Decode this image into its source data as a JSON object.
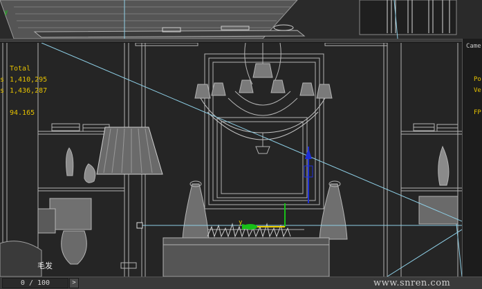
{
  "stats": {
    "total_label": "Total",
    "polys_prefix": "s",
    "polys_value": "1,410,295",
    "verts_prefix": "s",
    "verts_value": "1,436,287",
    "fps_value": "94.165"
  },
  "top_viewport": {
    "axis_label": "y"
  },
  "main_viewport": {
    "gizmo_label": "y",
    "object_label": "毛发"
  },
  "right_panel": {
    "camera_label": "Came",
    "polys_label": "Po",
    "verts_label": "Ve",
    "fps_label": "FP"
  },
  "status_bar": {
    "frame_counter": "0 / 100",
    "next_frame_glyph": ">"
  },
  "watermark": "www.snren.com",
  "colors": {
    "stats_text": "#e6c200",
    "wireframe": "#b4b4b4",
    "camera_line": "#8ecfe6",
    "gizmo_blue": "#1e2fd6",
    "gizmo_green": "#18c018",
    "gizmo_yellow": "#f0d000"
  },
  "icons": [
    "next-frame-icon",
    "viewport-gizmo-icon",
    "camera-line-icon"
  ]
}
